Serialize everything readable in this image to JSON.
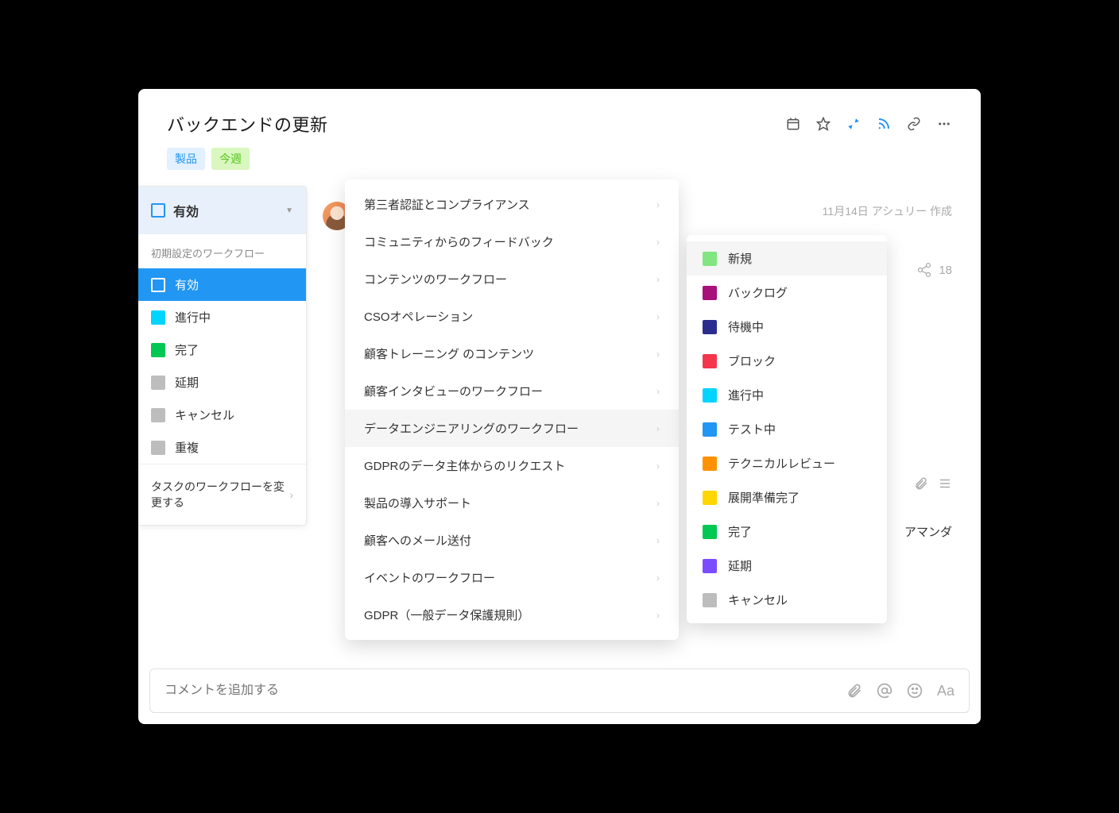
{
  "header": {
    "title": "バックエンドの更新",
    "tags": [
      {
        "label": "製品",
        "class": "tag-blue"
      },
      {
        "label": "今週",
        "class": "tag-green"
      }
    ]
  },
  "status_panel": {
    "header_label": "有効",
    "section_label": "初期設定のワークフロー",
    "items": [
      {
        "label": "有効",
        "color": "outline",
        "selected": true
      },
      {
        "label": "進行中",
        "color": "#00d4ff"
      },
      {
        "label": "完了",
        "color": "#00c853"
      },
      {
        "label": "延期",
        "color": "#bdbdbd"
      },
      {
        "label": "キャンセル",
        "color": "#bdbdbd"
      },
      {
        "label": "重複",
        "color": "#bdbdbd"
      }
    ],
    "footer_label": "タスクのワークフローを変更する"
  },
  "metadata_text": "11月14日 アシュリー 作成",
  "share_count": "18",
  "assignee": "アマンダ",
  "workflow_menu": [
    "第三者認証とコンプライアンス",
    "コミュニティからのフィードバック",
    "コンテンツのワークフロー",
    "CSOオペレーション",
    "顧客トレーニング のコンテンツ",
    "顧客インタビューのワークフロー",
    "データエンジニアリングのワークフロー",
    "GDPRのデータ主体からのリクエスト",
    "製品の導入サポート",
    "顧客へのメール送付",
    "イベントのワークフロー",
    "GDPR（一般データ保護規則）"
  ],
  "workflow_hovered_index": 6,
  "status_submenu": [
    {
      "label": "新規",
      "color": "#81e581"
    },
    {
      "label": "バックログ",
      "color": "#a8107a"
    },
    {
      "label": "待機中",
      "color": "#2b2d8e"
    },
    {
      "label": "ブロック",
      "color": "#f4364c"
    },
    {
      "label": "進行中",
      "color": "#00d4ff"
    },
    {
      "label": "テスト中",
      "color": "#2196f3"
    },
    {
      "label": "テクニカルレビュー",
      "color": "#ff9100"
    },
    {
      "label": "展開準備完了",
      "color": "#ffd600"
    },
    {
      "label": "完了",
      "color": "#00c853"
    },
    {
      "label": "延期",
      "color": "#7c4dff"
    },
    {
      "label": "キャンセル",
      "color": "#bdbdbd"
    }
  ],
  "submenu_hovered_index": 0,
  "comment_placeholder": "コメントを追加する"
}
